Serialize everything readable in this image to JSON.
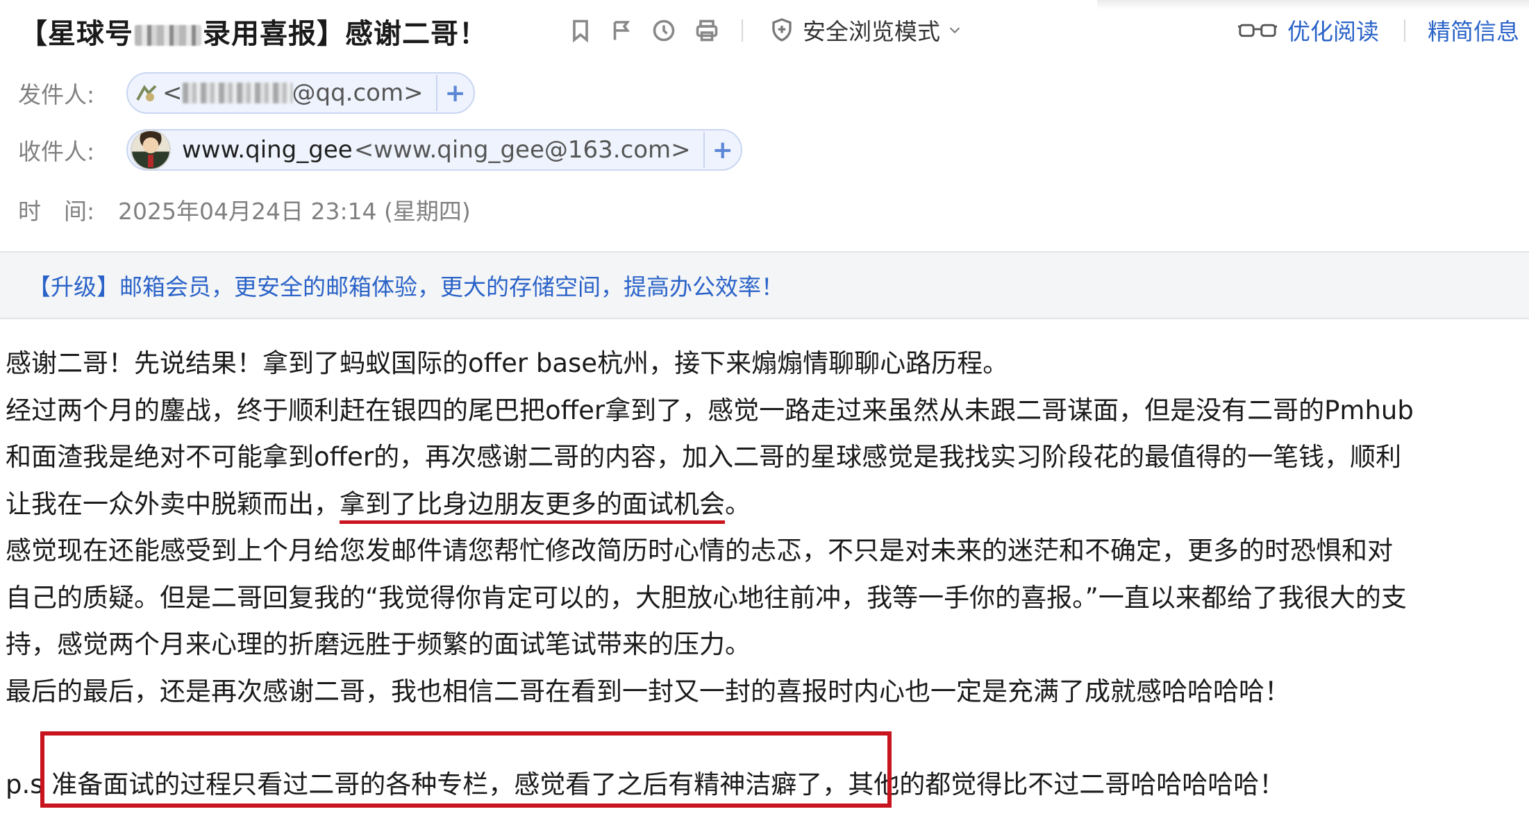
{
  "email": {
    "subject_prefix": "【星球号",
    "subject_suffix": "录用喜报】感谢二哥！",
    "toolbar": {
      "icons": [
        "bookmark-icon",
        "flag-icon",
        "clock-icon",
        "print-icon"
      ],
      "safe_mode_label": "安全浏览模式",
      "optimize_read_label": "优化阅读",
      "concise_info_label": "精简信息"
    },
    "sender": {
      "label": "发件人:",
      "address_prefix": "<",
      "address_suffix": "@qq.com>"
    },
    "recipient": {
      "label": "收件人:",
      "name": "www.qing_gee",
      "address": "<www.qing_gee@163.com>"
    },
    "time": {
      "label": "时　间:",
      "value": "2025年04月24日 23:14 (星期四)"
    },
    "promo": "【升级】邮箱会员，更安全的邮箱体验，更大的存储空间，提高办公效率！",
    "body": {
      "line1": "感谢二哥！先说结果！拿到了蚂蚁国际的offer base杭州，接下来煽煽情聊聊心路历程。",
      "line2": "经过两个月的鏖战，终于顺利赶在银四的尾巴把offer拿到了，感觉一路走过来虽然从未跟二哥谋面，但是没有二哥的Pmhub",
      "line3": "和面渣我是绝对不可能拿到offer的，再次感谢二哥的内容，加入二哥的星球感觉是我找实习阶段花的最值得的一笔钱，顺利",
      "line4_prefix": "让我在一众外卖中脱颖而出，",
      "line4_highlight": "拿到了比身边朋友更多的面试机会",
      "line4_suffix": "。",
      "line5": "感觉现在还能感受到上个月给您发邮件请您帮忙修改简历时心情的忐忑，不只是对未来的迷茫和不确定，更多的时恐惧和对",
      "line6": "自己的质疑。但是二哥回复我的“我觉得你肯定可以的，大胆放心地往前冲，我等一手你的喜报。”一直以来都给了我很大的支",
      "line7": "持，感觉两个月来心理的折磨远胜于频繁的面试笔试带来的压力。",
      "line8": "最后的最后，还是再次感谢二哥，我也相信二哥在看到一封又一封的喜报时内心也一定是充满了成就感哈哈哈哈！",
      "ps_prefix": "p.s",
      "ps_highlight": " 准备面试的过程只看过二哥的各种专栏，感觉看了之后有精神洁癖了",
      "ps_suffix": "，其他的都觉得比不过二哥哈哈哈哈哈！"
    }
  },
  "colors": {
    "link_blue": "#2a63c8",
    "highlight_red": "#c8141e",
    "promo_bg": "#f4f5f7",
    "chip_bg": "#eef3fd"
  }
}
